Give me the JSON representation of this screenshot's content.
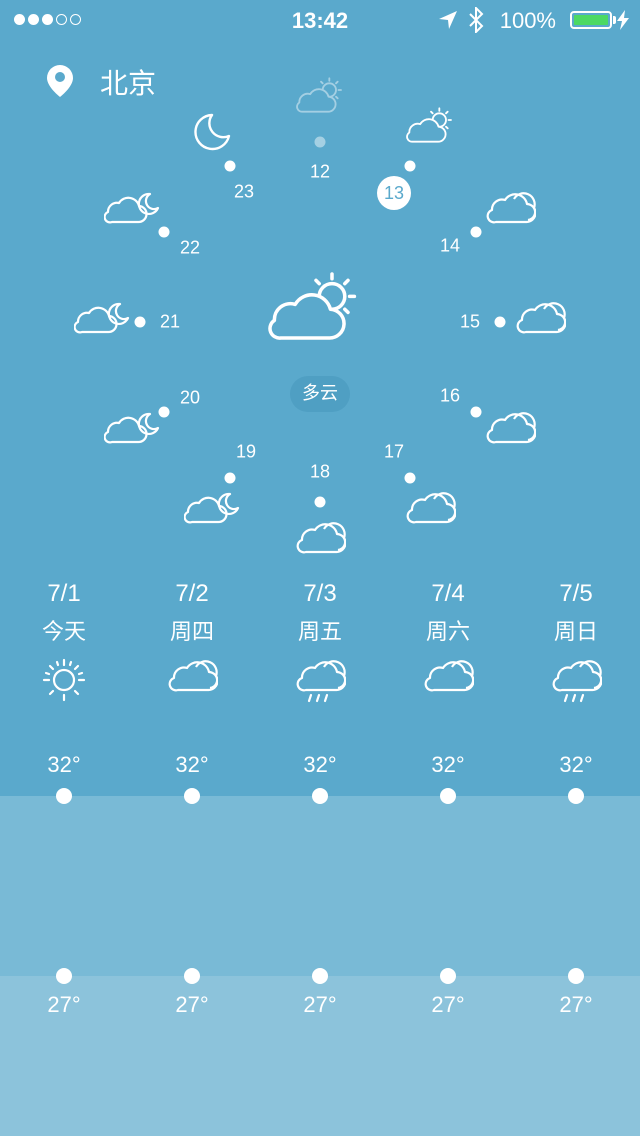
{
  "status": {
    "signal_dots": [
      true,
      true,
      true,
      false,
      false
    ],
    "time": "13:42",
    "battery_pct": "100%",
    "battery_level": 1.0,
    "battery_color": "#4cd964"
  },
  "location": {
    "city": "北京"
  },
  "current": {
    "hour": "13",
    "condition": "多云"
  },
  "hours": [
    {
      "label": "12",
      "icon": "partly-cloudy-sun-icon",
      "past": true
    },
    {
      "label": "14",
      "icon": "cloud-icon"
    },
    {
      "label": "15",
      "icon": "cloud-icon"
    },
    {
      "label": "16",
      "icon": "cloud-icon"
    },
    {
      "label": "17",
      "icon": "cloud-icon"
    },
    {
      "label": "18",
      "icon": "cloud-icon"
    },
    {
      "label": "19",
      "icon": "cloud-moon-icon"
    },
    {
      "label": "20",
      "icon": "cloud-moon-icon"
    },
    {
      "label": "21",
      "icon": "cloud-moon-icon"
    },
    {
      "label": "22",
      "icon": "cloud-moon-icon"
    },
    {
      "label": "23",
      "icon": "moon-icon"
    }
  ],
  "forecast": [
    {
      "date": "7/1",
      "day": "今天",
      "icon": "sun-icon",
      "high": "32°",
      "low": "27°"
    },
    {
      "date": "7/2",
      "day": "周四",
      "icon": "cloud-icon",
      "high": "32°",
      "low": "27°"
    },
    {
      "date": "7/3",
      "day": "周五",
      "icon": "rain-cloud-icon",
      "high": "32°",
      "low": "27°"
    },
    {
      "date": "7/4",
      "day": "周六",
      "icon": "cloud-icon",
      "high": "32°",
      "low": "27°"
    },
    {
      "date": "7/5",
      "day": "周日",
      "icon": "rain-cloud-icon",
      "high": "32°",
      "low": "27°"
    }
  ],
  "colors": {
    "background": "#5aa9cc",
    "high_band": "#79bad6",
    "low_band": "#8cc3db"
  }
}
